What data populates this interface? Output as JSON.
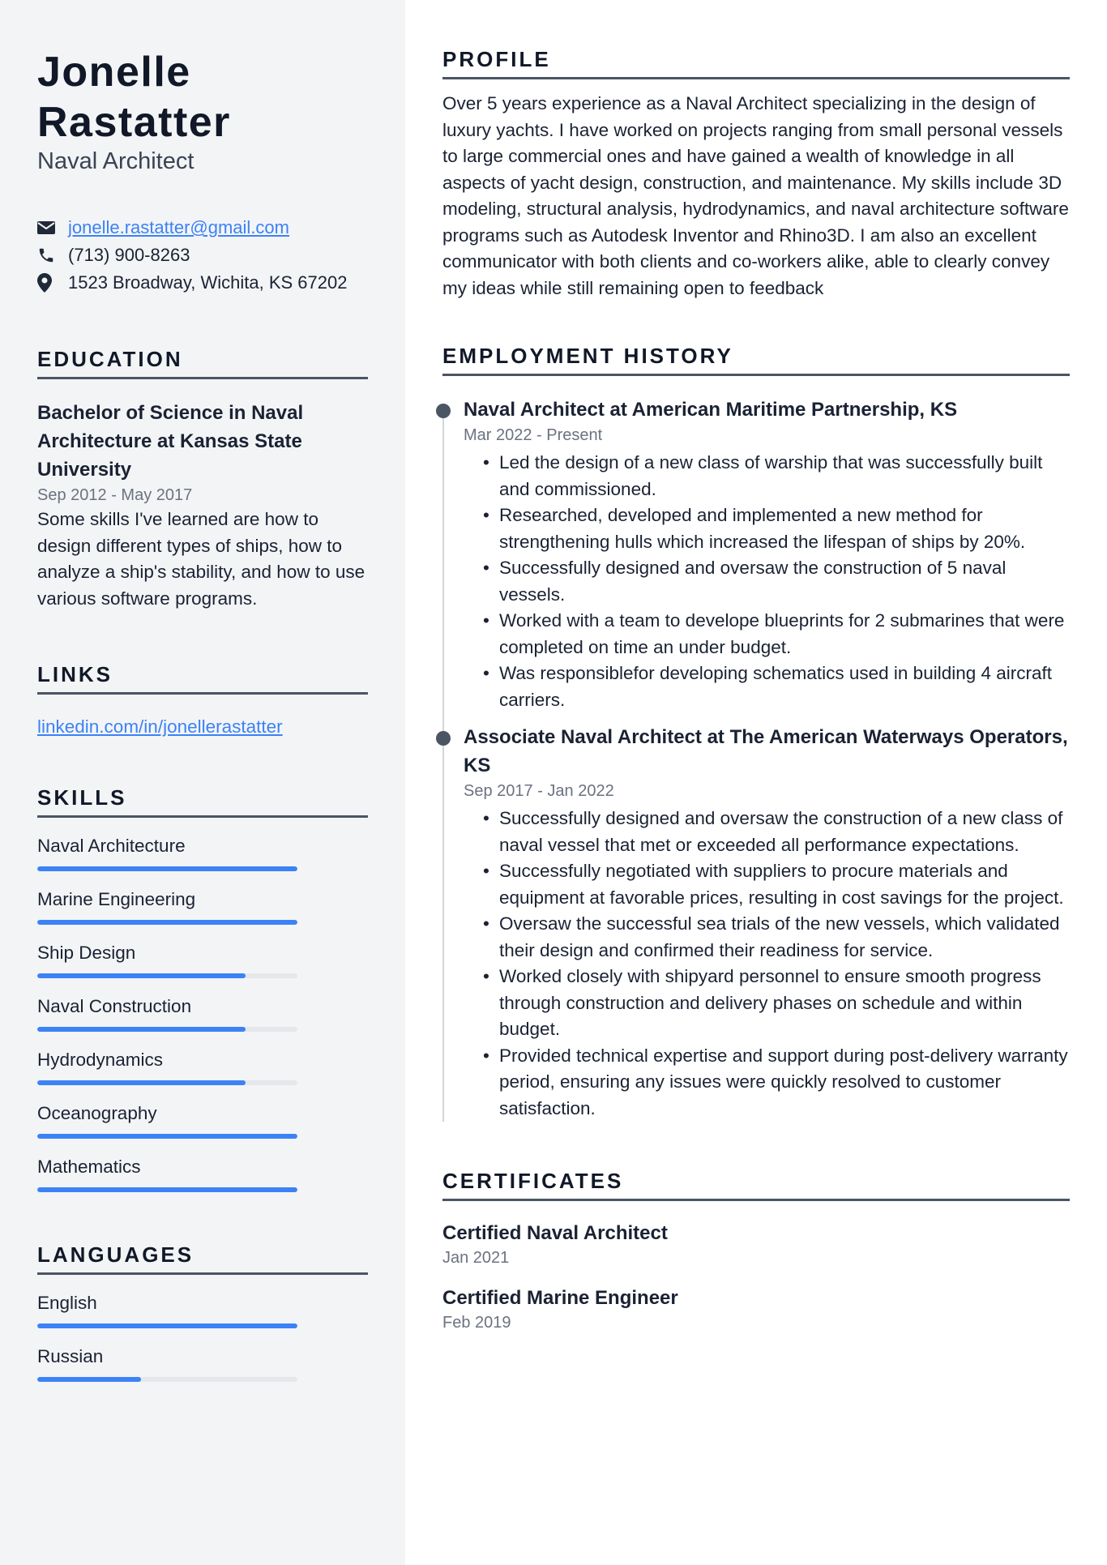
{
  "header": {
    "first_name": "Jonelle",
    "last_name": "Rastatter",
    "title": "Naval Architect"
  },
  "contact": {
    "email": "jonelle.rastatter@gmail.com",
    "phone": "(713) 900-8263",
    "address": "1523 Broadway, Wichita, KS 67202",
    "icons": [
      "envelope-icon",
      "phone-icon",
      "map-pin-icon"
    ]
  },
  "education": {
    "heading": "EDUCATION",
    "degree": "Bachelor of Science in Naval Architecture at Kansas State University",
    "dates": "Sep 2012 - May 2017",
    "description": "Some skills I've learned are how to design different types of ships, how to analyze a ship's stability, and how to use various software programs."
  },
  "links": {
    "heading": "LINKS",
    "items": [
      "linkedin.com/in/jonellerastatter"
    ]
  },
  "skills": {
    "heading": "SKILLS",
    "items": [
      {
        "label": "Naval Architecture",
        "level": 100
      },
      {
        "label": "Marine Engineering",
        "level": 100
      },
      {
        "label": "Ship Design",
        "level": 80
      },
      {
        "label": "Naval Construction",
        "level": 80
      },
      {
        "label": "Hydrodynamics",
        "level": 80
      },
      {
        "label": "Oceanography",
        "level": 100
      },
      {
        "label": "Mathematics",
        "level": 100
      }
    ]
  },
  "languages": {
    "heading": "LANGUAGES",
    "items": [
      {
        "label": "English",
        "level": 100
      },
      {
        "label": "Russian",
        "level": 40
      }
    ]
  },
  "profile": {
    "heading": "PROFILE",
    "text": "Over 5 years experience as a Naval Architect specializing in the design of luxury yachts. I have worked on projects ranging from small personal vessels to large commercial ones and have gained a wealth of knowledge in all aspects of yacht design, construction, and maintenance. My skills include 3D modeling, structural analysis, hydrodynamics, and naval architecture software programs such as Autodesk Inventor and Rhino3D. I am also an excellent communicator with both clients and co-workers alike, able to clearly convey my ideas while still remaining open to feedback"
  },
  "employment": {
    "heading": "EMPLOYMENT HISTORY",
    "jobs": [
      {
        "title": "Naval Architect at American Maritime Partnership, KS",
        "dates": "Mar 2022 - Present",
        "bullets": [
          "Led the design of a new class of warship that was successfully built and commissioned.",
          "Researched, developed and implemented a new method for strengthening hulls which increased the lifespan of ships by 20%.",
          "Successfully designed and oversaw the construction of 5 naval vessels.",
          "Worked with a team to develope blueprints for 2 submarines that were completed on time an under budget.",
          "Was responsiblefor developing schematics used in building 4 aircraft carriers."
        ]
      },
      {
        "title": "Associate Naval Architect at The American Waterways Operators, KS",
        "dates": "Sep 2017 - Jan 2022",
        "bullets": [
          "Successfully designed and oversaw the construction of a new class of naval vessel that met or exceeded all performance expectations.",
          "Successfully negotiated with suppliers to procure materials and equipment at favorable prices, resulting in cost savings for the project.",
          "Oversaw the successful sea trials of the new vessels, which validated their design and confirmed their readiness for service.",
          "Worked closely with shipyard personnel to ensure smooth progress through construction and delivery phases on schedule and within budget.",
          "Provided technical expertise and support during post-delivery warranty period, ensuring any issues were quickly resolved to customer satisfaction."
        ]
      }
    ]
  },
  "certificates": {
    "heading": "CERTIFICATES",
    "items": [
      {
        "title": "Certified Naval Architect",
        "date": "Jan 2021"
      },
      {
        "title": "Certified Marine Engineer",
        "date": "Feb 2019"
      }
    ]
  },
  "colors": {
    "accent": "#3b82f6",
    "sidebar_bg": "#f3f4f6",
    "text": "#1a2233",
    "muted": "#6b7280",
    "rule": "#4b5563"
  }
}
